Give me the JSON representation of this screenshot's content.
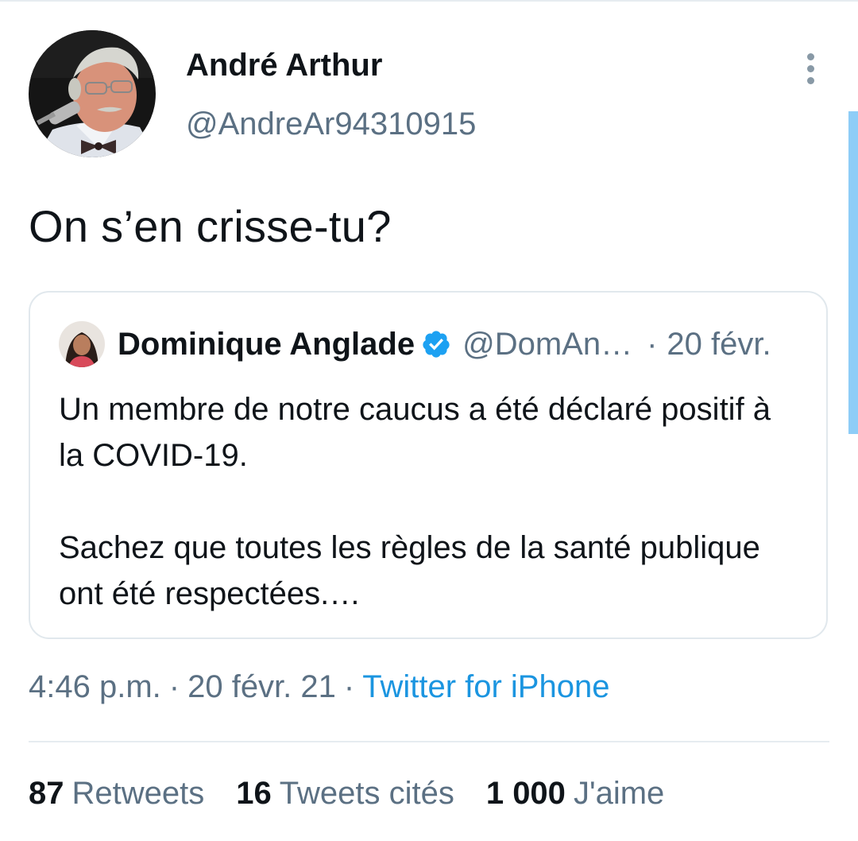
{
  "tweet": {
    "author": {
      "name": "André Arthur",
      "handle": "@AndreAr94310915"
    },
    "text": "On s’en crisse-tu?",
    "quoted": {
      "name": "Dominique Anglade",
      "verified": true,
      "handle": "@DomAn…",
      "separator": "·",
      "date": "20 févr.",
      "paragraphs": [
        "Un membre de notre caucus a été déclaré positif à la COVID-19.",
        "Sachez que toutes les règles de la santé publique ont été respectées.…"
      ]
    },
    "meta": {
      "time": "4:46 p.m.",
      "separator": "·",
      "date": "20 févr. 21",
      "source": "Twitter for iPhone"
    },
    "stats": {
      "retweets": {
        "count": "87",
        "label": "Retweets"
      },
      "quotes": {
        "count": "16",
        "label": "Tweets cités"
      },
      "likes": {
        "count": "1 000",
        "label": "J'aime"
      }
    }
  },
  "colors": {
    "text": "#0f1419",
    "secondary": "#5b7083",
    "link": "#1b95e0",
    "verified": "#1da1f2",
    "border": "#e1e8ed"
  },
  "icons": {
    "more": "more-vertical-icon",
    "verified": "verified-badge-icon"
  }
}
